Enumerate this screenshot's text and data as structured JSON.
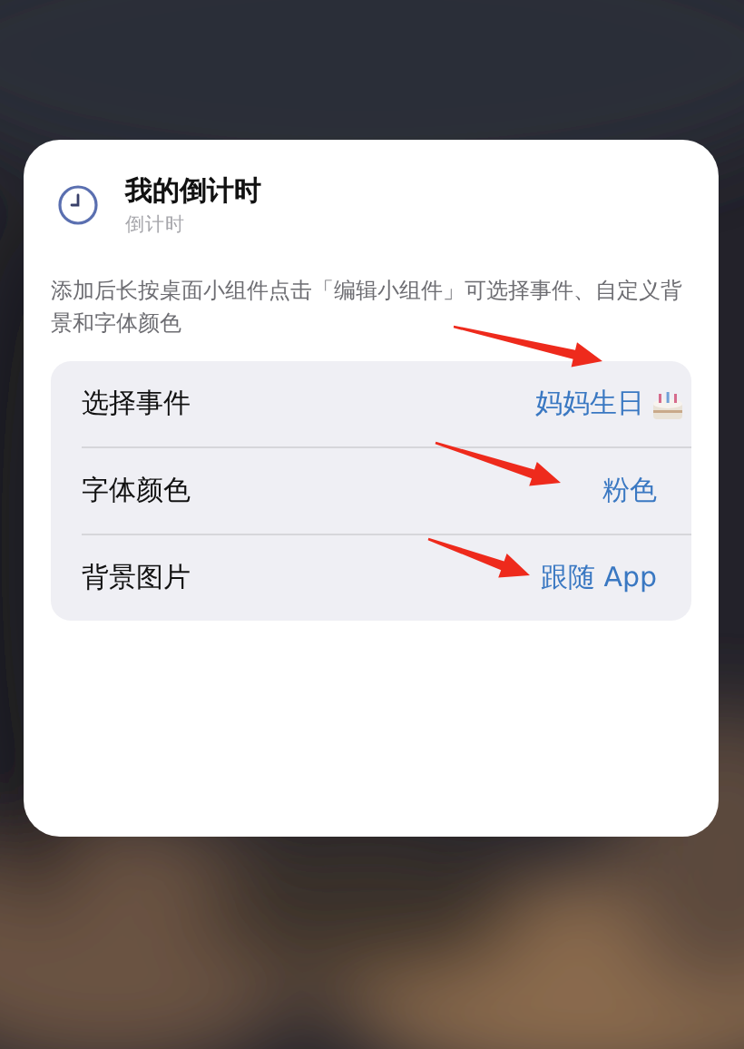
{
  "widget": {
    "title": "我的倒计时",
    "subtitle": "倒计时"
  },
  "description": "添加后长按桌面小组件点击「编辑小组件」可选择事件、自定义背景和字体颜色",
  "settings": [
    {
      "label": "选择事件",
      "value": "妈妈生日",
      "kind": "cake"
    },
    {
      "label": "字体颜色",
      "value": "粉色",
      "kind": "plain"
    },
    {
      "label": "背景图片",
      "value": "跟随 App",
      "kind": "plain"
    }
  ]
}
